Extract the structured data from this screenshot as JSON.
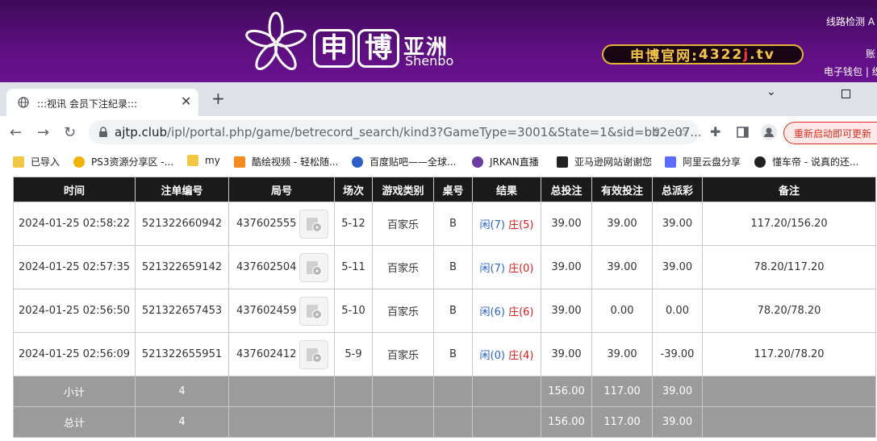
{
  "site": {
    "brand_char1": "申",
    "brand_char2": "博",
    "brand_cn": "亚洲",
    "brand_en": "Shenbo",
    "official_prefix": "申博官网:",
    "official_num": "4322",
    "official_red": "j",
    "official_suffix": ".tv",
    "right_line_check": "线路检测",
    "right_line_check_tail": "A",
    "right_account": "账",
    "right_wallet": "电子钱包",
    "right_sep": "| 织"
  },
  "browser": {
    "tab_title": ":::视讯 会员下注纪录:::",
    "tab_close": "✕",
    "new_tab": "+",
    "url_host": "ajtp.club",
    "url_path": "/ipl/portal.php/game/betrecord_search/kind3?GameType=3001&State=1&sid=bb2e07...",
    "restart_label": "重新启动即可更新",
    "bookmarks": [
      {
        "label": "已导入",
        "color": "#f2c744"
      },
      {
        "label": "PS3资源分享区 -...",
        "color": "#f0b400"
      },
      {
        "label": "my",
        "color": "#f2c744"
      },
      {
        "label": "酷绘视频 - 轻松随...",
        "color": "#f58a1f"
      },
      {
        "label": "百度贴吧——全球...",
        "color": "#2f5ec4"
      },
      {
        "label": "JRKAN直播",
        "color": "#6a3ea1"
      },
      {
        "label": "亚马逊网站谢谢您",
        "color": "#222222"
      },
      {
        "label": "阿里云盘分享",
        "color": "#5b6cff"
      },
      {
        "label": "懂车帝 - 说真的还...",
        "color": "#222222"
      }
    ]
  },
  "table": {
    "headers": [
      "时间",
      "注单编号",
      "局号",
      "场次",
      "游戏类别",
      "桌号",
      "结果",
      "总投注",
      "有效投注",
      "总派彩",
      "备注"
    ],
    "rows": [
      {
        "time": "2024-01-25 02:58:22",
        "bet_id": "521322660942",
        "round": "437602555",
        "session": "5-12",
        "game": "百家乐",
        "table": "B",
        "player": "闲(7)",
        "banker": "庄(5)",
        "total": "39.00",
        "valid": "39.00",
        "payout": "39.00",
        "payout_neg": false,
        "note": "117.20/156.20"
      },
      {
        "time": "2024-01-25 02:57:35",
        "bet_id": "521322659142",
        "round": "437602504",
        "session": "5-11",
        "game": "百家乐",
        "table": "B",
        "player": "闲(7)",
        "banker": "庄(0)",
        "total": "39.00",
        "valid": "39.00",
        "payout": "39.00",
        "payout_neg": false,
        "note": "78.20/117.20"
      },
      {
        "time": "2024-01-25 02:56:50",
        "bet_id": "521322657453",
        "round": "437602459",
        "session": "5-10",
        "game": "百家乐",
        "table": "B",
        "player": "闲(6)",
        "banker": "庄(6)",
        "total": "39.00",
        "valid": "0.00",
        "payout": "0.00",
        "payout_neg": false,
        "note": "78.20/78.20"
      },
      {
        "time": "2024-01-25 02:56:09",
        "bet_id": "521322655951",
        "round": "437602412",
        "session": "5-9",
        "game": "百家乐",
        "table": "B",
        "player": "闲(0)",
        "banker": "庄(4)",
        "total": "39.00",
        "valid": "39.00",
        "payout": "-39.00",
        "payout_neg": true,
        "note": "117.20/78.20"
      }
    ],
    "subtotal": {
      "label": "小计",
      "count": "4",
      "total": "156.00",
      "valid": "117.00",
      "payout": "39.00"
    },
    "grandtotal": {
      "label": "总计",
      "count": "4",
      "total": "156.00",
      "valid": "117.00",
      "payout": "39.00"
    }
  },
  "colors": {
    "header_purple": "#5e0f80",
    "accent_blue": "#2a63c9",
    "accent_red": "#d42020",
    "gold": "#e2b33a"
  }
}
